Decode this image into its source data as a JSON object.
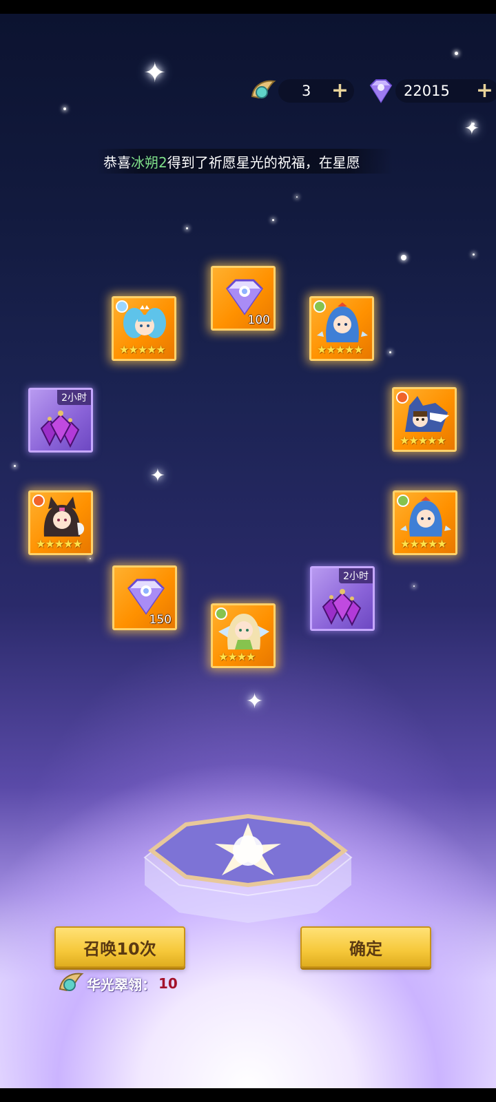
{
  "resources": {
    "feather_count": "3",
    "gem_count": "22015",
    "plus_symbol": "+"
  },
  "notice": {
    "prefix": "恭喜",
    "player": "冰朔2",
    "suffix": "得到了祈愿星光的祝福，在星愿"
  },
  "rewards": [
    {
      "id": "gem-100",
      "type": "gem",
      "amount": "100"
    },
    {
      "id": "hero-ice",
      "type": "hero",
      "stars": "★★★★★",
      "element": "ice"
    },
    {
      "id": "hero-mermaid-1",
      "type": "hero",
      "stars": "★★★★★",
      "element": "nature"
    },
    {
      "id": "potion-1",
      "type": "potion",
      "duration": "2小时"
    },
    {
      "id": "hero-wolf",
      "type": "hero",
      "stars": "★★★★★",
      "element": "fire"
    },
    {
      "id": "hero-fox",
      "type": "hero",
      "stars": "★★★★★",
      "element": "fire"
    },
    {
      "id": "hero-mermaid-2",
      "type": "hero",
      "stars": "★★★★★",
      "element": "nature"
    },
    {
      "id": "gem-150",
      "type": "gem",
      "amount": "150"
    },
    {
      "id": "potion-2",
      "type": "potion",
      "duration": "2小时"
    },
    {
      "id": "hero-elf",
      "type": "hero",
      "stars": "★★★★",
      "element": "nature"
    }
  ],
  "buttons": {
    "summon_label": "召唤10次",
    "confirm_label": "确定"
  },
  "cost": {
    "label": "华光翠翎：",
    "value": "10"
  },
  "colors": {
    "card_gold": "#ff9a10",
    "card_purple": "#8a63d8",
    "button_yellow": "#f6c83a",
    "highlight_green": "#7fe08a",
    "cost_red": "#a3122a"
  }
}
